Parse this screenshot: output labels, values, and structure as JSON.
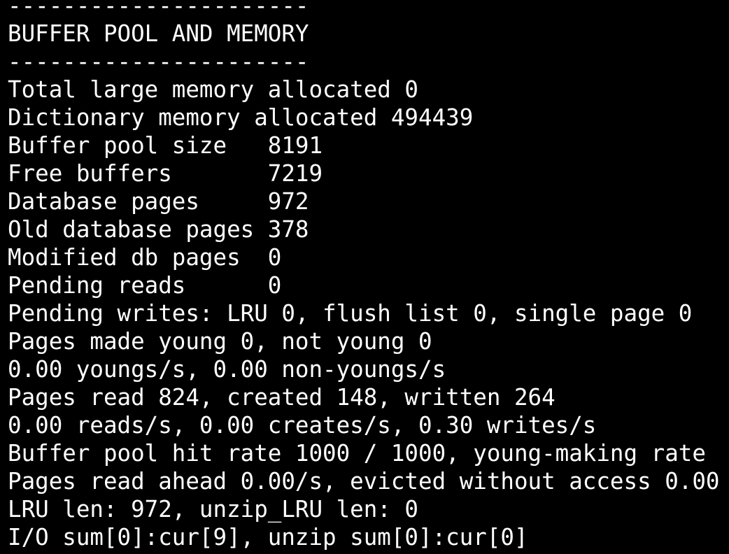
{
  "terminal": {
    "foreground": "#ffffff",
    "background": "#000000",
    "lines": [
      "----------------------",
      "BUFFER POOL AND MEMORY",
      "----------------------",
      "Total large memory allocated 0",
      "Dictionary memory allocated 494439",
      "Buffer pool size   8191",
      "Free buffers       7219",
      "Database pages     972",
      "Old database pages 378",
      "Modified db pages  0",
      "Pending reads      0",
      "Pending writes: LRU 0, flush list 0, single page 0",
      "Pages made young 0, not young 0",
      "0.00 youngs/s, 0.00 non-youngs/s",
      "Pages read 824, created 148, written 264",
      "0.00 reads/s, 0.00 creates/s, 0.30 writes/s",
      "Buffer pool hit rate 1000 / 1000, young-making rate",
      "Pages read ahead 0.00/s, evicted without access 0.00",
      "LRU len: 972, unzip_LRU len: 0",
      "I/O sum[0]:cur[9], unzip sum[0]:cur[0]"
    ]
  }
}
